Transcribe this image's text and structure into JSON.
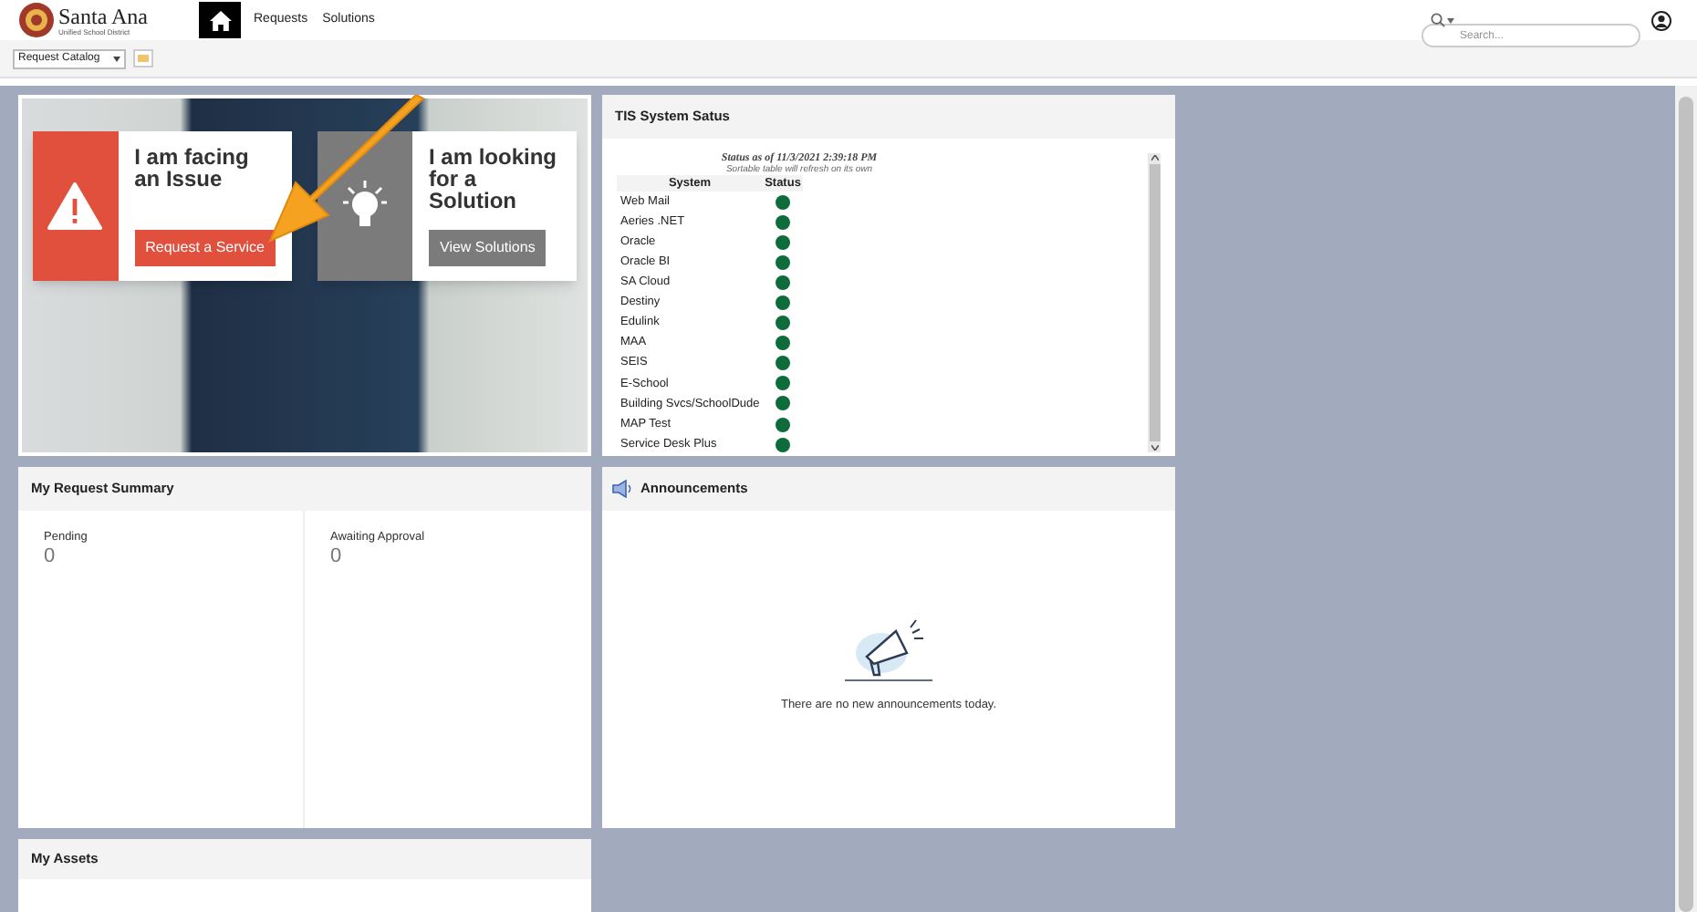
{
  "header": {
    "logo_title": "Santa Ana",
    "logo_subtitle": "Unified School District",
    "nav": [
      {
        "label": "Requests",
        "selected": false
      },
      {
        "label": "Solutions",
        "selected": false
      }
    ],
    "home_selected": true,
    "search": {
      "placeholder": "Search..."
    }
  },
  "toolbar": {
    "catalog_select": "Request Catalog"
  },
  "hero": {
    "cards": [
      {
        "kind": "issue",
        "title": "I am facing an Issue",
        "button": "Request a Service"
      },
      {
        "kind": "solution",
        "title": "I am looking for a Solution",
        "button": "View Solutions"
      }
    ]
  },
  "system_status": {
    "title": "TIS System Satus",
    "status_line": "Status as of 11/3/2021 2:39:18 PM",
    "note": "Sortable table will refresh on its own",
    "columns": [
      "System",
      "Status"
    ],
    "rows": [
      {
        "system": "Web Mail",
        "color": "#0e6b3a"
      },
      {
        "system": "Aeries .NET",
        "color": "#0e6b3a"
      },
      {
        "system": "Oracle",
        "color": "#0e6b3a"
      },
      {
        "system": "Oracle BI",
        "color": "#0e6b3a"
      },
      {
        "system": "SA Cloud",
        "color": "#0e6b3a"
      },
      {
        "system": "Destiny",
        "color": "#0e6b3a"
      },
      {
        "system": "Edulink",
        "color": "#0e6b3a"
      },
      {
        "system": "MAA",
        "color": "#0e6b3a"
      },
      {
        "system": "SEIS",
        "color": "#0e6b3a"
      },
      {
        "system": "E-School",
        "color": "#0e6b3a"
      },
      {
        "system": "Building Svcs/SchoolDude",
        "color": "#0e6b3a"
      },
      {
        "system": "MAP Test",
        "color": "#0e6b3a"
      },
      {
        "system": "Service Desk Plus",
        "color": "#0e6b3a"
      }
    ]
  },
  "request_summary": {
    "title": "My Request Summary",
    "stats": [
      {
        "label": "Pending",
        "value": "0"
      },
      {
        "label": "Awaiting Approval",
        "value": "0"
      }
    ]
  },
  "announcements": {
    "title": "Announcements",
    "empty_text": "There are no new announcements today."
  },
  "assets": {
    "title": "My Assets"
  }
}
